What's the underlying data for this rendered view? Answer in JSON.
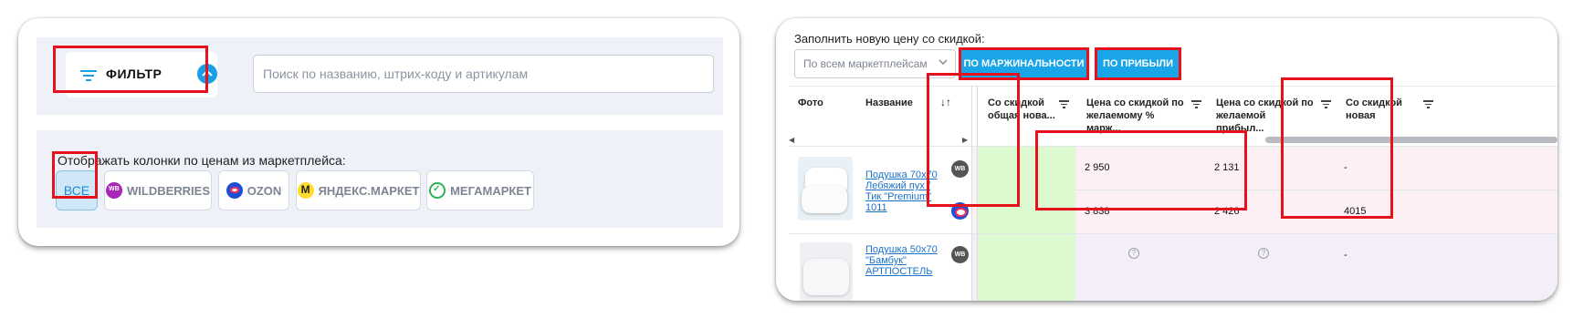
{
  "filter_card": {
    "filter_label": "ФИЛЬТР",
    "search_placeholder": "Поиск по названию, штрих-коду и артикулам",
    "marketplace_caption": "Отображать колонки по ценам из маркетплейса:",
    "marketplaces": [
      {
        "label": "ВСЕ",
        "active": true
      },
      {
        "label": "WILDBERRIES",
        "active": false,
        "icon": "wildberries-icon"
      },
      {
        "label": "OZON",
        "active": false,
        "icon": "ozon-icon"
      },
      {
        "label": "ЯНДЕКС.МАРКЕТ",
        "active": false,
        "icon": "yandex-market-icon"
      },
      {
        "label": "МЕГАМАРКЕТ",
        "active": false,
        "icon": "megamarket-icon"
      }
    ]
  },
  "pricing_card": {
    "fill_caption": "Заполнить новую цену со скидкой:",
    "marketplace_select": "По всем маркетплейсам",
    "btn_margin": "ПО МАРЖИНАЛЬНОСТИ",
    "btn_profit": "ПО ПРИБЫЛИ",
    "columns": {
      "photo": "Фото",
      "name": "Название",
      "discount_total_new": "Со скидкой общая нова...",
      "price_margin": "Цена со скидкой по желаемому % марж...",
      "price_profit": "Цена со скидкой по желаемой прибыл...",
      "discount_new": "Со скидкой новая"
    },
    "rows": [
      {
        "product": "Подушка 70х70 Лебяжий пух / Тик \"Premium\" 1011",
        "lines": [
          {
            "mp": "WB",
            "price_margin": "2 950",
            "price_profit": "2 131",
            "discount_new": "-"
          },
          {
            "mp": "OZON",
            "price_margin": "3 838",
            "price_profit": "2 426",
            "discount_new": "4015"
          }
        ]
      },
      {
        "product": "Подушка 50х70 \"Бамбук\" АРТПОСТЕЛЬ",
        "lines": [
          {
            "mp": "WB",
            "price_margin": "?",
            "price_profit": "?",
            "discount_new": "-"
          }
        ]
      }
    ]
  },
  "colors": {
    "accent": "#1aa5e8",
    "highlight": "#e5121b",
    "green_cell": "#dcf9d0",
    "pink_row": "#fdf0f4",
    "lavender_row": "#f4eefb"
  }
}
